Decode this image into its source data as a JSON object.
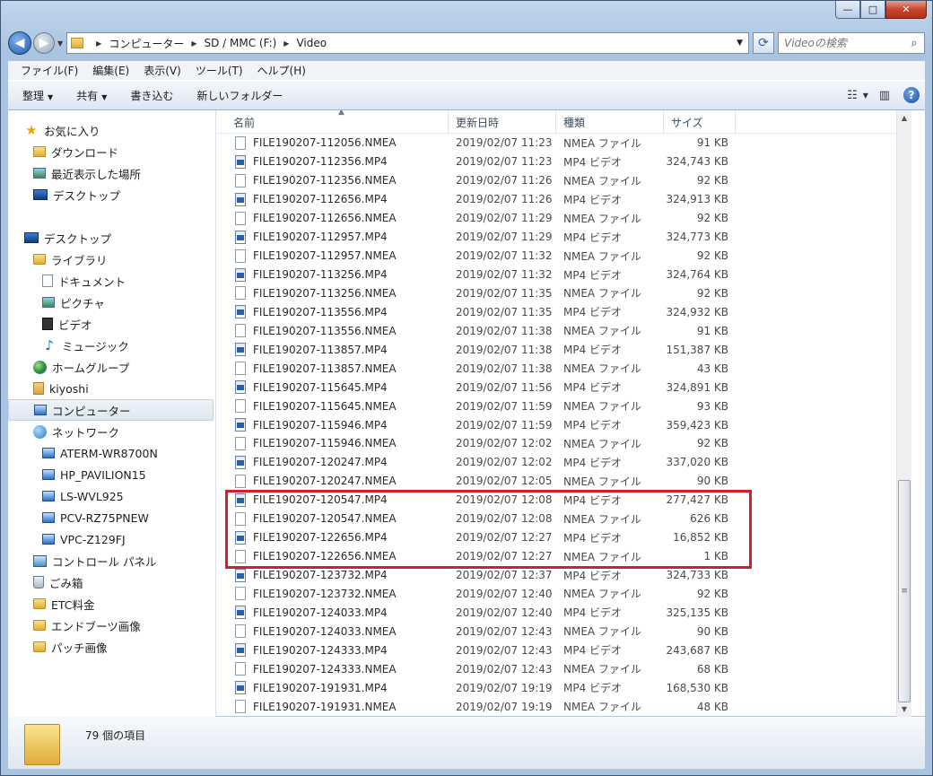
{
  "window": {
    "caption": {
      "minimize": "—",
      "maximize": "□",
      "close": "✕"
    }
  },
  "address": {
    "crumbs": [
      "コンピューター",
      "SD / MMC (F:)",
      "Video"
    ],
    "search_placeholder": "Videoの検索"
  },
  "menubar": [
    "ファイル(F)",
    "編集(E)",
    "表示(V)",
    "ツール(T)",
    "ヘルプ(H)"
  ],
  "commands": {
    "organize": "整理",
    "share": "共有",
    "burn": "書き込む",
    "new_folder": "新しいフォルダー"
  },
  "nav": {
    "favorites": "お気に入り",
    "downloads": "ダウンロード",
    "recent": "最近表示した場所",
    "desktop_fav": "デスクトップ",
    "desktop": "デスクトップ",
    "libraries": "ライブラリ",
    "documents": "ドキュメント",
    "pictures": "ピクチャ",
    "videos": "ビデオ",
    "music": "ミュージック",
    "homegroup": "ホームグループ",
    "user": "kiyoshi",
    "computer": "コンピューター",
    "network": "ネットワーク",
    "net_hosts": [
      "ATERM-WR8700N",
      "HP_PAVILION15",
      "LS-WVL925",
      "PCV-RZ75PNEW",
      "VPC-Z129FJ"
    ],
    "control_panel": "コントロール パネル",
    "recycle": "ごみ箱",
    "folders": [
      "ETC料金",
      "エンドブーツ画像",
      "パッチ画像"
    ]
  },
  "columns": {
    "name": "名前",
    "date": "更新日時",
    "type": "種類",
    "size": "サイズ"
  },
  "files": [
    {
      "name": "FILE190207-112056.NMEA",
      "date": "2019/02/07 11:23",
      "type": "NMEA ファイル",
      "size": "91 KB",
      "kind": "nmea"
    },
    {
      "name": "FILE190207-112356.MP4",
      "date": "2019/02/07 11:23",
      "type": "MP4 ビデオ",
      "size": "324,743 KB",
      "kind": "mp4"
    },
    {
      "name": "FILE190207-112356.NMEA",
      "date": "2019/02/07 11:26",
      "type": "NMEA ファイル",
      "size": "92 KB",
      "kind": "nmea"
    },
    {
      "name": "FILE190207-112656.MP4",
      "date": "2019/02/07 11:26",
      "type": "MP4 ビデオ",
      "size": "324,913 KB",
      "kind": "mp4"
    },
    {
      "name": "FILE190207-112656.NMEA",
      "date": "2019/02/07 11:29",
      "type": "NMEA ファイル",
      "size": "92 KB",
      "kind": "nmea"
    },
    {
      "name": "FILE190207-112957.MP4",
      "date": "2019/02/07 11:29",
      "type": "MP4 ビデオ",
      "size": "324,773 KB",
      "kind": "mp4"
    },
    {
      "name": "FILE190207-112957.NMEA",
      "date": "2019/02/07 11:32",
      "type": "NMEA ファイル",
      "size": "92 KB",
      "kind": "nmea"
    },
    {
      "name": "FILE190207-113256.MP4",
      "date": "2019/02/07 11:32",
      "type": "MP4 ビデオ",
      "size": "324,764 KB",
      "kind": "mp4"
    },
    {
      "name": "FILE190207-113256.NMEA",
      "date": "2019/02/07 11:35",
      "type": "NMEA ファイル",
      "size": "92 KB",
      "kind": "nmea"
    },
    {
      "name": "FILE190207-113556.MP4",
      "date": "2019/02/07 11:35",
      "type": "MP4 ビデオ",
      "size": "324,932 KB",
      "kind": "mp4"
    },
    {
      "name": "FILE190207-113556.NMEA",
      "date": "2019/02/07 11:38",
      "type": "NMEA ファイル",
      "size": "91 KB",
      "kind": "nmea"
    },
    {
      "name": "FILE190207-113857.MP4",
      "date": "2019/02/07 11:38",
      "type": "MP4 ビデオ",
      "size": "151,387 KB",
      "kind": "mp4"
    },
    {
      "name": "FILE190207-113857.NMEA",
      "date": "2019/02/07 11:38",
      "type": "NMEA ファイル",
      "size": "43 KB",
      "kind": "nmea"
    },
    {
      "name": "FILE190207-115645.MP4",
      "date": "2019/02/07 11:56",
      "type": "MP4 ビデオ",
      "size": "324,891 KB",
      "kind": "mp4"
    },
    {
      "name": "FILE190207-115645.NMEA",
      "date": "2019/02/07 11:59",
      "type": "NMEA ファイル",
      "size": "93 KB",
      "kind": "nmea"
    },
    {
      "name": "FILE190207-115946.MP4",
      "date": "2019/02/07 11:59",
      "type": "MP4 ビデオ",
      "size": "359,423 KB",
      "kind": "mp4"
    },
    {
      "name": "FILE190207-115946.NMEA",
      "date": "2019/02/07 12:02",
      "type": "NMEA ファイル",
      "size": "92 KB",
      "kind": "nmea"
    },
    {
      "name": "FILE190207-120247.MP4",
      "date": "2019/02/07 12:02",
      "type": "MP4 ビデオ",
      "size": "337,020 KB",
      "kind": "mp4"
    },
    {
      "name": "FILE190207-120247.NMEA",
      "date": "2019/02/07 12:05",
      "type": "NMEA ファイル",
      "size": "90 KB",
      "kind": "nmea"
    },
    {
      "name": "FILE190207-120547.MP4",
      "date": "2019/02/07 12:08",
      "type": "MP4 ビデオ",
      "size": "277,427 KB",
      "kind": "mp4"
    },
    {
      "name": "FILE190207-120547.NMEA",
      "date": "2019/02/07 12:08",
      "type": "NMEA ファイル",
      "size": "626 KB",
      "kind": "nmea"
    },
    {
      "name": "FILE190207-122656.MP4",
      "date": "2019/02/07 12:27",
      "type": "MP4 ビデオ",
      "size": "16,852 KB",
      "kind": "mp4"
    },
    {
      "name": "FILE190207-122656.NMEA",
      "date": "2019/02/07 12:27",
      "type": "NMEA ファイル",
      "size": "1 KB",
      "kind": "nmea"
    },
    {
      "name": "FILE190207-123732.MP4",
      "date": "2019/02/07 12:37",
      "type": "MP4 ビデオ",
      "size": "324,733 KB",
      "kind": "mp4"
    },
    {
      "name": "FILE190207-123732.NMEA",
      "date": "2019/02/07 12:40",
      "type": "NMEA ファイル",
      "size": "92 KB",
      "kind": "nmea"
    },
    {
      "name": "FILE190207-124033.MP4",
      "date": "2019/02/07 12:40",
      "type": "MP4 ビデオ",
      "size": "325,135 KB",
      "kind": "mp4"
    },
    {
      "name": "FILE190207-124033.NMEA",
      "date": "2019/02/07 12:43",
      "type": "NMEA ファイル",
      "size": "90 KB",
      "kind": "nmea"
    },
    {
      "name": "FILE190207-124333.MP4",
      "date": "2019/02/07 12:43",
      "type": "MP4 ビデオ",
      "size": "243,687 KB",
      "kind": "mp4"
    },
    {
      "name": "FILE190207-124333.NMEA",
      "date": "2019/02/07 12:43",
      "type": "NMEA ファイル",
      "size": "68 KB",
      "kind": "nmea"
    },
    {
      "name": "FILE190207-191931.MP4",
      "date": "2019/02/07 19:19",
      "type": "MP4 ビデオ",
      "size": "168,530 KB",
      "kind": "mp4"
    },
    {
      "name": "FILE190207-191931.NMEA",
      "date": "2019/02/07 19:19",
      "type": "NMEA ファイル",
      "size": "48 KB",
      "kind": "nmea"
    }
  ],
  "details": {
    "count": "79 個の項目"
  },
  "colors": {
    "highlight": "#d61e2a",
    "accent": "#1f5aa7"
  }
}
